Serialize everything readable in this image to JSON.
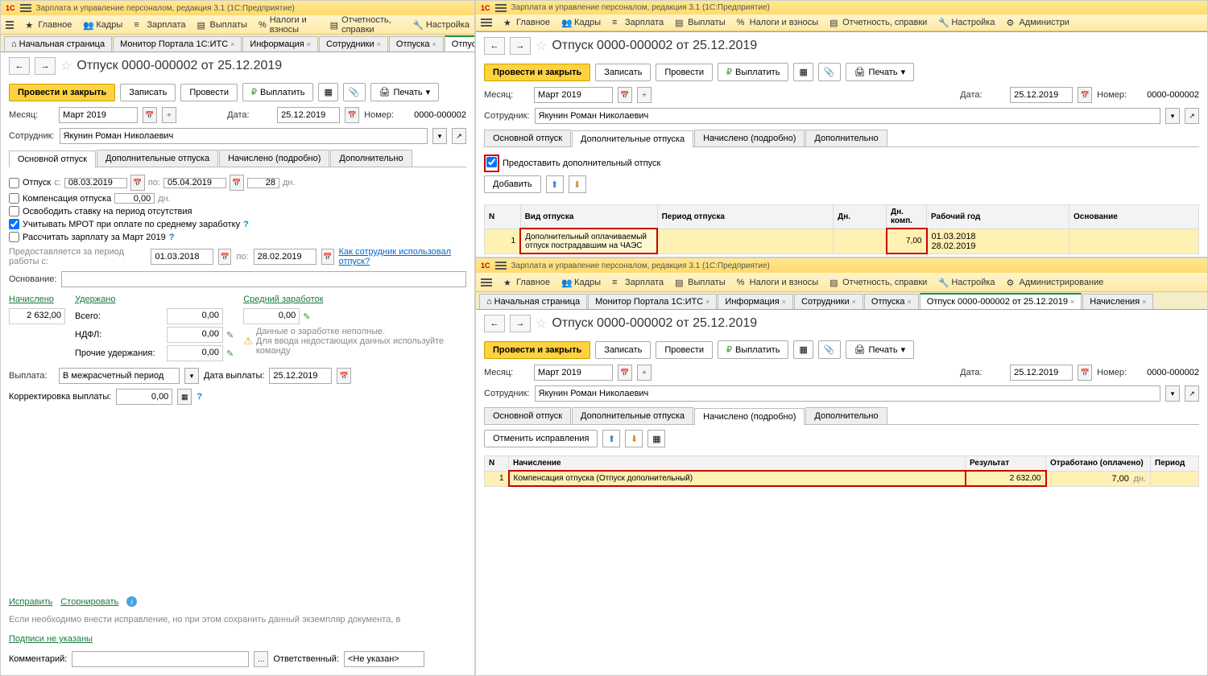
{
  "app": {
    "title": "Зарплата и управление персоналом, редакция 3.1  (1С:Предприятие)"
  },
  "menu": {
    "main": "Главное",
    "kadry": "Кадры",
    "zarplata": "Зарплата",
    "vyplaty": "Выплаты",
    "nalogi": "Налоги и взносы",
    "otchet": "Отчетность, справки",
    "nastroika": "Настройка",
    "admin": "Администрирование",
    "admin_short": "Администри"
  },
  "wtabs": {
    "home": "Начальная страница",
    "portal": "Монитор Портала 1С:ИТС",
    "info": "Информация",
    "sotr": "Сотрудники",
    "otp": "Отпуска",
    "doc": "Отпуск 0000-000002 от 25.12.2019",
    "nach": "Начисления",
    "nach_short": "Начислени"
  },
  "doc": {
    "title": "Отпуск 0000-000002 от 25.12.2019",
    "btn_post_close": "Провести и закрыть",
    "btn_save": "Записать",
    "btn_post": "Провести",
    "btn_pay": "Выплатить",
    "btn_print": "Печать",
    "month_lbl": "Месяц:",
    "month": "Март 2019",
    "date_lbl": "Дата:",
    "date": "25.12.2019",
    "num_lbl": "Номер:",
    "num": "0000-000002",
    "emp_lbl": "Сотрудник:",
    "emp": "Якунин Роман Николаевич"
  },
  "tabs": {
    "t1": "Основной отпуск",
    "t2": "Дополнительные отпуска",
    "t3": "Начислено (подробно)",
    "t4": "Дополнительно"
  },
  "mainLeaveTab": {
    "otpusk": "Отпуск",
    "s": "с:",
    "d1": "08.03.2019",
    "po": "по:",
    "d2": "05.04.2019",
    "days": "28",
    "dn": "дн.",
    "komp": "Компенсация отпуска",
    "komp_v": "0,00",
    "free": "Освободить ставку на период отсутствия",
    "mrot": "Учитывать МРОТ при оплате по среднему заработку",
    "recalc": "Рассчитать зарплату за Март 2019",
    "period_lbl": "Предоставляется за период работы с:",
    "p1": "01.03.2018",
    "p2": "28.02.2019",
    "used_link": "Как сотрудник использовал отпуск?",
    "osn_lbl": "Основание:"
  },
  "summary": {
    "nach": "Начислено",
    "nach_v": "2 632,00",
    "uder": "Удержано",
    "vsego": "Всего:",
    "ndfl": "НДФЛ:",
    "prochie": "Прочие удержания:",
    "z": "0,00",
    "sred": "Средний заработок",
    "sred_v": "0,00",
    "warn1": "Данные о заработке неполные.",
    "warn2": "Для ввода недостающих данных используйте команду"
  },
  "payout": {
    "vyplata": "Выплата:",
    "period": "В межрасчетный период",
    "date_lbl": "Дата выплаты:",
    "date": "25.12.2019",
    "korr": "Корректировка выплаты:",
    "korr_v": "0,00"
  },
  "footer": {
    "ispr": "Исправить",
    "storn": "Сторнировать",
    "note": "Если необходимо внести исправление, но при этом сохранить данный экземпляр документа, в",
    "podpisi": "Подписи не указаны",
    "comm": "Комментарий:",
    "otv": "Ответственный:",
    "otv_v": "<Не указан>"
  },
  "addTab": {
    "grant": "Предоставить дополнительный отпуск",
    "add_btn": "Добавить",
    "cols": {
      "n": "N",
      "vid": "Вид отпуска",
      "per": "Период отпуска",
      "dn": "Дн.",
      "dnk": "Дн. комп.",
      "god": "Рабочий год",
      "osn": "Основание"
    },
    "row": {
      "n": "1",
      "vid": "Дополнительный оплачиваемый отпуск пострадавшим на ЧАЭС",
      "dnk": "7,00",
      "g1": "01.03.2018",
      "g2": "28.02.2019"
    }
  },
  "calcTab": {
    "cancel": "Отменить исправления",
    "cols": {
      "n": "N",
      "nach": "Начисление",
      "res": "Результат",
      "otr": "Отработано (оплачено)",
      "per": "Период"
    },
    "row": {
      "n": "1",
      "nach": "Компенсация отпуска (Отпуск дополнительный)",
      "res": "2 632,00",
      "otr": "7,00",
      "dn": "дн."
    }
  }
}
